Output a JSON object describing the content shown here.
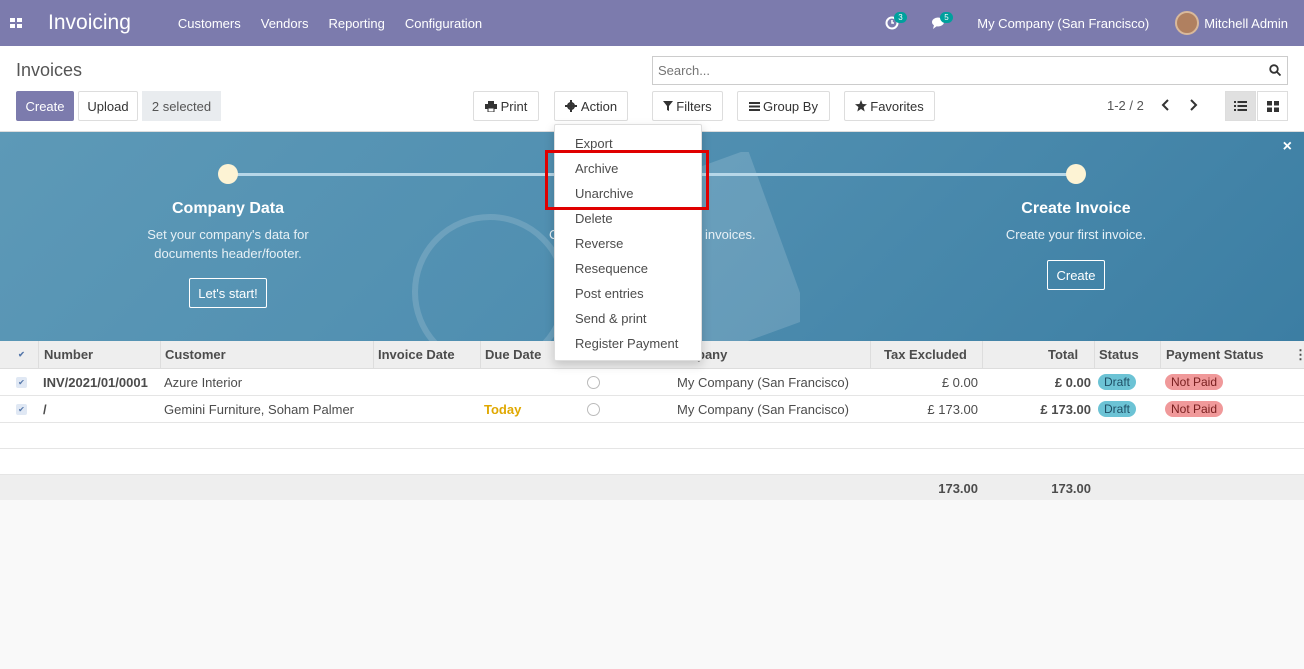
{
  "navbar": {
    "app_title": "Invoicing",
    "menu": [
      "Customers",
      "Vendors",
      "Reporting",
      "Configuration"
    ],
    "activity_count": "3",
    "message_count": "5",
    "company": "My Company (San Francisco)",
    "user": "Mitchell Admin",
    "bg_color": "#7c7bad"
  },
  "control_panel": {
    "breadcrumb": "Invoices",
    "create_label": "Create",
    "upload_label": "Upload",
    "selected_label": "2 selected",
    "print_label": "Print",
    "action_label": "Action",
    "search_placeholder": "Search...",
    "filters_label": "Filters",
    "groupby_label": "Group By",
    "favorites_label": "Favorites",
    "pager": "1-2 / 2"
  },
  "action_menu": {
    "items": [
      "Export",
      "Archive",
      "Unarchive",
      "Delete",
      "Reverse",
      "Resequence",
      "Post entries",
      "Send & print",
      "Register Payment"
    ]
  },
  "banner": {
    "steps": [
      {
        "title": "Company Data",
        "desc1": "Set your company's data for",
        "desc2": "documents header/footer.",
        "button": "Let's start!"
      },
      {
        "title": "Create Invoice",
        "desc1": "Create your first invoice.",
        "desc2": "",
        "button": "Create"
      }
    ],
    "partial_desc_tail": "invoices.",
    "partial_desc_head": "C"
  },
  "table": {
    "headers": {
      "number": "Number",
      "customer": "Customer",
      "invoice_date": "Invoice Date",
      "due_date": "Due Date",
      "company": "pany",
      "tax_excluded": "Tax Excluded",
      "total": "Total",
      "status": "Status",
      "payment_status": "Payment Status"
    },
    "rows": [
      {
        "number": "INV/2021/01/0001",
        "customer": "Azure Interior",
        "due_date": "",
        "company": "My Company (San Francisco)",
        "tax_excluded": "£ 0.00",
        "total": "£ 0.00",
        "status": "Draft",
        "payment_status": "Not Paid"
      },
      {
        "number": "/",
        "customer": "Gemini Furniture, Soham Palmer",
        "due_date": "Today",
        "company": "My Company (San Francisco)",
        "tax_excluded": "£ 173.00",
        "total": "£ 173.00",
        "status": "Draft",
        "payment_status": "Not Paid"
      }
    ],
    "footer": {
      "tax_excluded": "173.00",
      "total": "173.00"
    }
  }
}
